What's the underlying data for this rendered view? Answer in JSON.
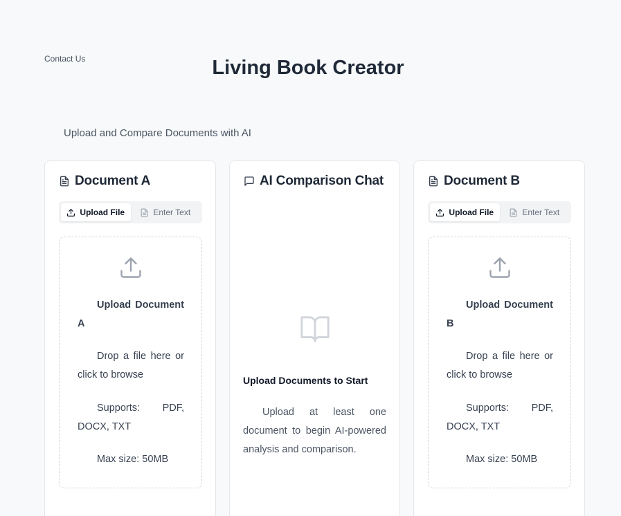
{
  "header": {
    "contact_label": "Contact Us",
    "title": "Living Book Creator",
    "subtitle": "Upload and Compare Documents with AI"
  },
  "document_a": {
    "title": "Document A",
    "tabs": [
      "Upload File",
      "Enter Text"
    ],
    "active_tab": "Upload File",
    "dropzone": {
      "title": "Upload Document A",
      "description": "Drop a file here or click to browse",
      "supports": "Supports: PDF, DOCX, TXT",
      "max_size": "Max size: 50MB"
    }
  },
  "chat": {
    "title": "AI Comparison Chat",
    "empty_title": "Upload Documents to Start",
    "empty_description": "Upload at least one document to begin AI-powered analysis and comparison."
  },
  "document_b": {
    "title": "Document B",
    "tabs": [
      "Upload File",
      "Enter Text"
    ],
    "active_tab": "Upload File",
    "dropzone": {
      "title": "Upload Document B",
      "description": "Drop a file here or click to browse",
      "supports": "Supports: PDF, DOCX, TXT",
      "max_size": "Max size: 50MB"
    }
  },
  "icons": {
    "document": "file-text-icon",
    "chat": "message-square-icon",
    "upload": "upload-icon",
    "book": "book-open-icon"
  },
  "colors": {
    "background": "#f7f9fa",
    "panel": "#ffffff",
    "border": "#e5e7eb",
    "icon_muted": "#9ca3af"
  }
}
